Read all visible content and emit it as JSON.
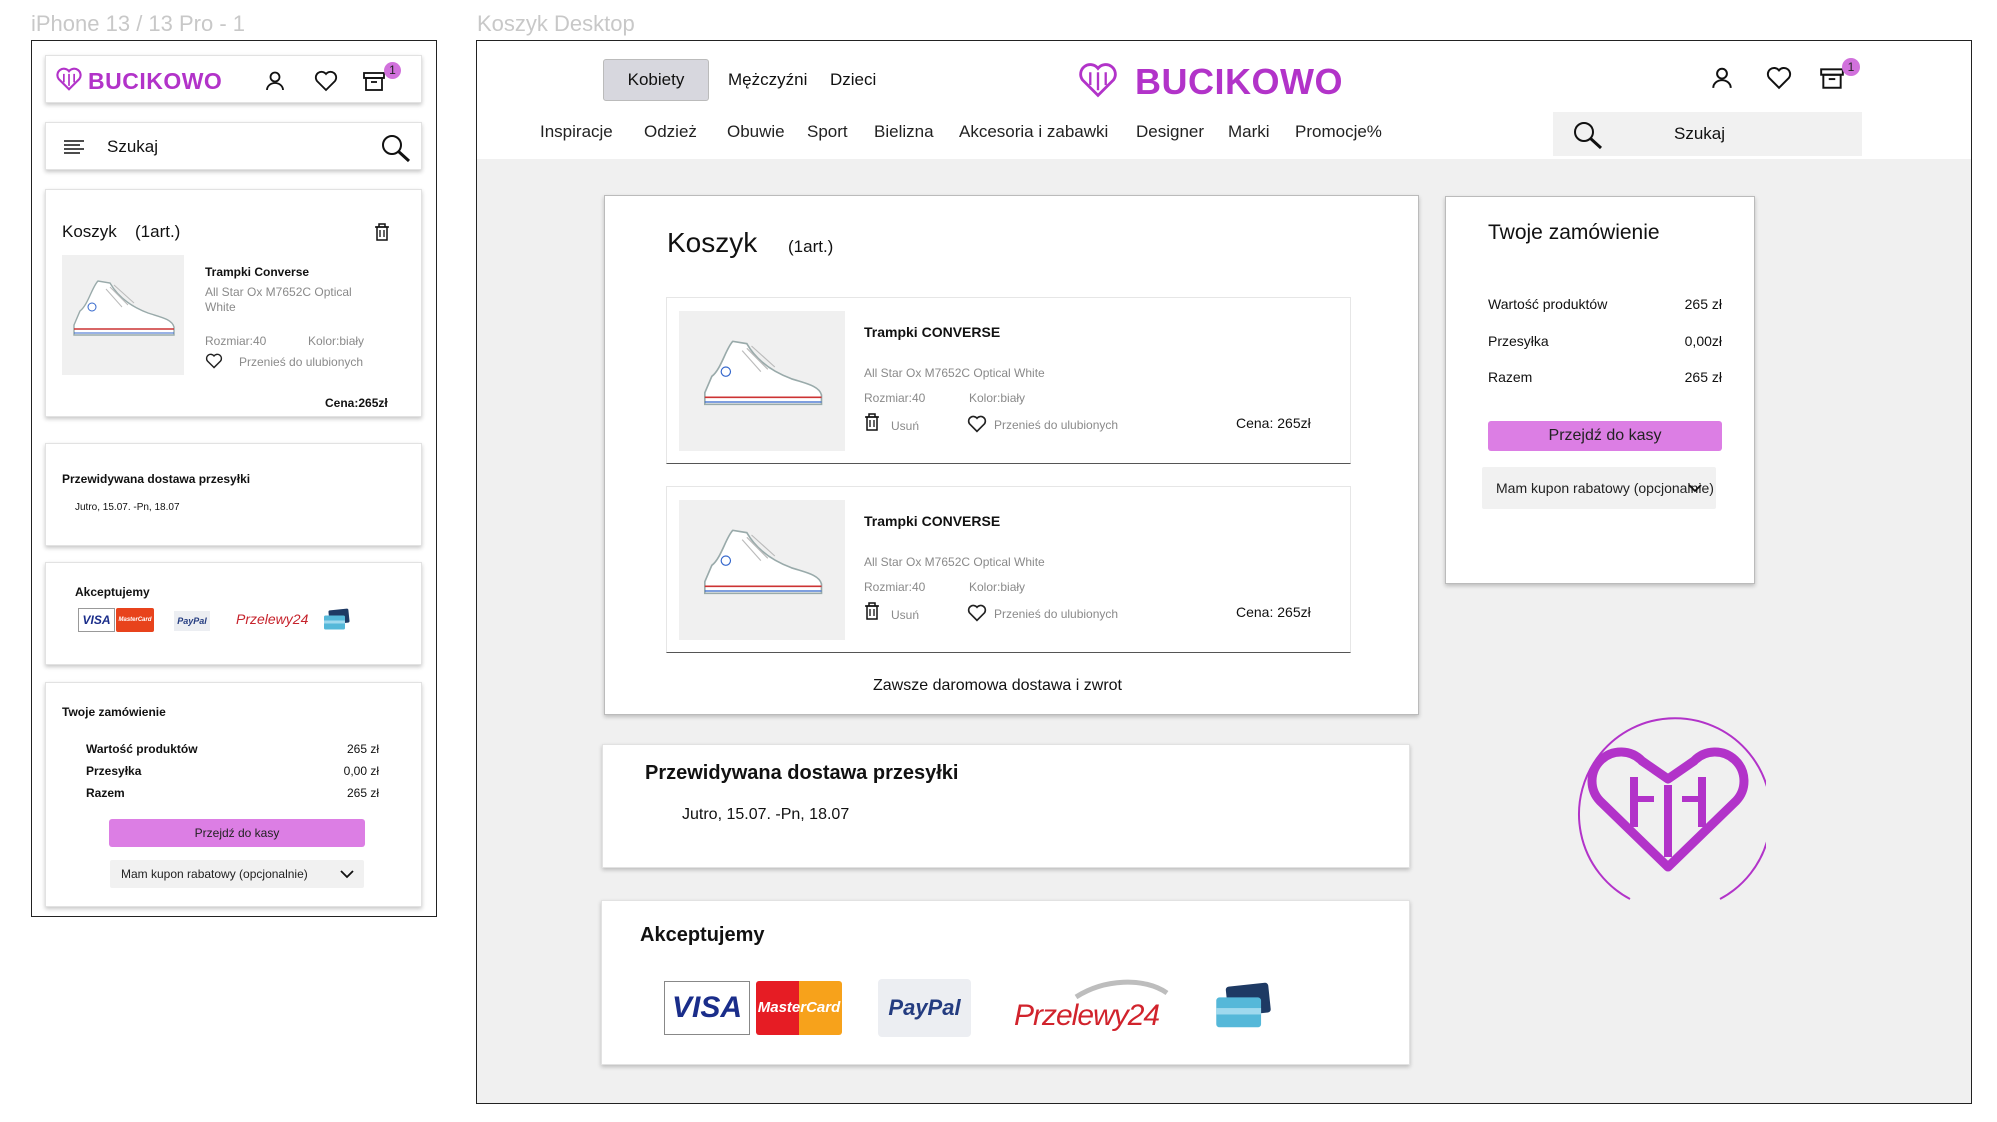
{
  "mobile": {
    "frame_label": "iPhone 13 / 13 Pro - 1",
    "brand": "BUCIKOWO",
    "badge_count": "1",
    "search_placeholder": "Szukaj",
    "cart": {
      "title": "Koszyk",
      "count": "(1art.)",
      "item": {
        "name": "Trampki Converse",
        "desc": "All Star Ox M7652C Optical White",
        "size": "Rozmiar:40",
        "color": "Kolor:biały",
        "fav": "Przenieś do ulubionych",
        "price": "Cena:265zł"
      }
    },
    "delivery": {
      "title": "Przewidywana dostawa przesyłki",
      "dates": "Jutro, 15.07. -Pn, 18.07"
    },
    "payments": {
      "title": "Akceptujemy"
    },
    "order": {
      "title": "Twoje zamówienie",
      "rows": [
        {
          "label": "Wartość produktów",
          "value": "265 zł"
        },
        {
          "label": "Przesyłka",
          "value": "0,00 zł"
        },
        {
          "label": "Razem",
          "value": "265 zł"
        }
      ],
      "checkout": "Przejdź do kasy",
      "coupon": "Mam kupon rabatowy (opcjonalnie)"
    }
  },
  "desktop": {
    "frame_label": "Koszyk Desktop",
    "tabs": [
      "Kobiety",
      "Mężczyźni",
      "Dzieci"
    ],
    "brand": "BUCIKOWO",
    "badge_count": "1",
    "nav": [
      "Inspiracje",
      "Odzież",
      "Obuwie",
      "Sport",
      "Bielizna",
      "Akcesoria i zabawki",
      "Designer",
      "Marki",
      "Promocje%"
    ],
    "search_placeholder": "Szukaj",
    "cart": {
      "title": "Koszyk",
      "count": "(1art.)",
      "items": [
        {
          "name": "Trampki CONVERSE",
          "desc": "All Star Ox M7652C Optical White",
          "size": "Rozmiar:40",
          "color": "Kolor:biały",
          "remove": "Usuń",
          "fav": "Przenieś do ulubionych",
          "price": "Cena: 265zł"
        },
        {
          "name": "Trampki CONVERSE",
          "desc": "All Star Ox M7652C Optical White",
          "size": "Rozmiar:40",
          "color": "Kolor:biały",
          "remove": "Usuń",
          "fav": "Przenieś do ulubionych",
          "price": "Cena: 265zł"
        }
      ],
      "free_shipping": "Zawsze daromowa dostawa i zwrot"
    },
    "delivery": {
      "title": "Przewidywana dostawa przesyłki",
      "dates": "Jutro, 15.07. -Pn, 18.07"
    },
    "payments": {
      "title": "Akceptujemy"
    },
    "order": {
      "title": "Twoje zamówienie",
      "rows": [
        {
          "label": "Wartość produktów",
          "value": "265 zł"
        },
        {
          "label": "Przesyłka",
          "value": "0,00zł"
        },
        {
          "label": "Razem",
          "value": "265 zł"
        }
      ],
      "checkout": "Przejdź do kasy",
      "coupon": "Mam kupon rabatowy (opcjonalnie)"
    }
  },
  "payment_logos": {
    "visa": "VISA",
    "mastercard": "MasterCard",
    "paypal": "PayPal",
    "przelewy": "Przelewy24"
  },
  "colors": {
    "brand": "#b233c9",
    "button": "#dc7ee4",
    "badge": "#d171dc",
    "desktop_bg": "#f0f0f0"
  }
}
